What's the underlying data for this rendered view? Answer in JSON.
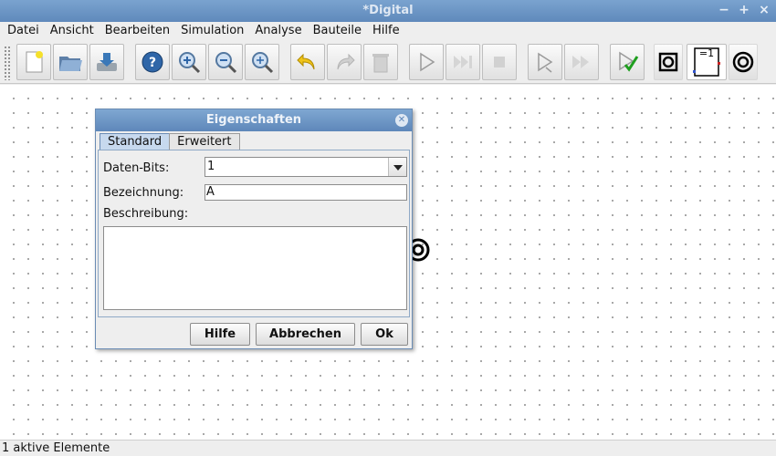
{
  "window": {
    "title": "*Digital",
    "minimize": "−",
    "maximize": "+",
    "close": "×"
  },
  "menu": [
    "Datei",
    "Ansicht",
    "Bearbeiten",
    "Simulation",
    "Analyse",
    "Bauteile",
    "Hilfe"
  ],
  "toolbar": {
    "icons": [
      "new-file-icon",
      "open-folder-icon",
      "save-icon",
      "help-icon",
      "zoom-in-icon",
      "zoom-out-icon",
      "zoom-fit-icon",
      "undo-icon",
      "redo-icon",
      "delete-icon",
      "run-icon",
      "step-icon",
      "stop-icon",
      "analysis-icon",
      "fast-forward-icon",
      "test-check-icon",
      "input-icon",
      "gate-icon",
      "output-icon"
    ],
    "gate_label": "=1"
  },
  "status": {
    "text": "1 aktive Elemente"
  },
  "dialog": {
    "title": "Eigenschaften",
    "tabs": [
      "Standard",
      "Erweitert"
    ],
    "active_tab": "Standard",
    "fields": {
      "bits_label": "Daten-Bits:",
      "bits_value": "1",
      "name_label": "Bezeichnung:",
      "name_value": "A",
      "desc_label": "Beschreibung:",
      "desc_value": ""
    },
    "buttons": {
      "help": "Hilfe",
      "cancel": "Abbrechen",
      "ok": "Ok"
    }
  }
}
